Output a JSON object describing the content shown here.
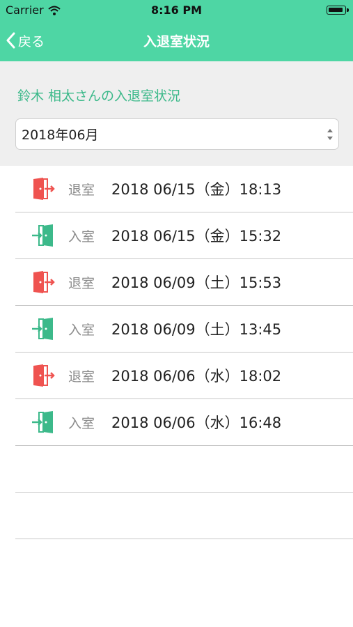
{
  "status_bar": {
    "carrier": "Carrier",
    "time": "8:16 PM",
    "wifi_icon": "wifi-icon",
    "battery_icon": "battery-icon"
  },
  "nav": {
    "back_label": "戻る",
    "title": "入退室状況"
  },
  "header": {
    "subtitle": "鈴木 相太さんの入退室状況",
    "month_value": "2018年06月"
  },
  "colors": {
    "accent": "#4ed6a4",
    "exit": "#ef5350",
    "entry": "#3cb98a"
  },
  "records": [
    {
      "type": "exit",
      "label": "退室",
      "datetime": "2018 06/15（金）18:13",
      "icon": "exit-door-icon"
    },
    {
      "type": "entry",
      "label": "入室",
      "datetime": "2018 06/15（金）15:32",
      "icon": "entry-door-icon"
    },
    {
      "type": "exit",
      "label": "退室",
      "datetime": "2018 06/09（土）15:53",
      "icon": "exit-door-icon"
    },
    {
      "type": "entry",
      "label": "入室",
      "datetime": "2018 06/09（土）13:45",
      "icon": "entry-door-icon"
    },
    {
      "type": "exit",
      "label": "退室",
      "datetime": "2018 06/06（水）18:02",
      "icon": "exit-door-icon"
    },
    {
      "type": "entry",
      "label": "入室",
      "datetime": "2018 06/06（水）16:48",
      "icon": "entry-door-icon"
    }
  ]
}
